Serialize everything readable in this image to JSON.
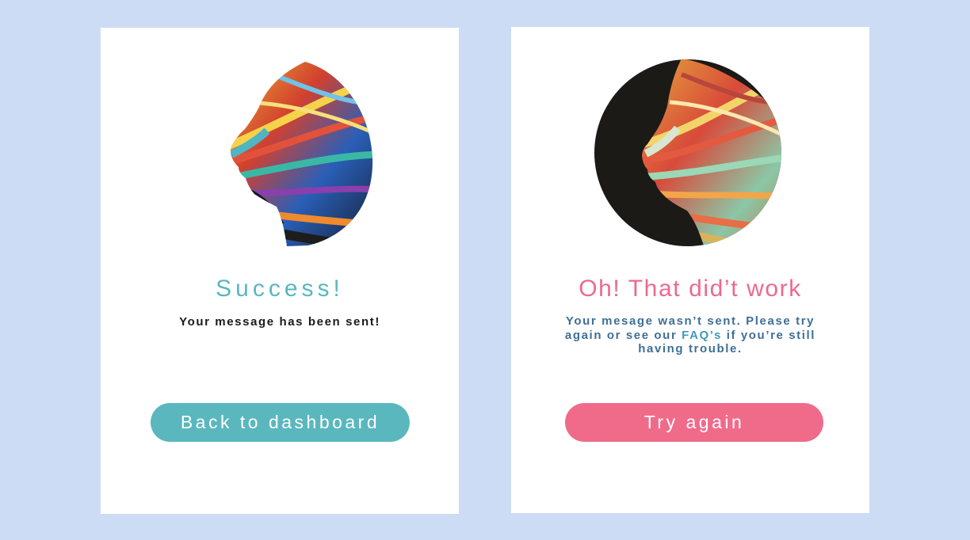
{
  "success": {
    "image_icon": "profile-head-art",
    "title": "Success!",
    "message": "Your message has been sent!",
    "button_label": "Back to dashboard"
  },
  "error": {
    "image_icon": "profile-head-art",
    "title": "Oh! That did’t work",
    "message_before": "Your mesage wasn’t sent. Please try again or see our ",
    "faq_link": "FAQ’s",
    "message_after": " if you’re still having trouble.",
    "button_label": "Try again"
  },
  "colors": {
    "background": "#cddcf5",
    "success_accent": "#5ab7bd",
    "error_accent": "#f06b8a",
    "error_text": "#3f6f95"
  }
}
